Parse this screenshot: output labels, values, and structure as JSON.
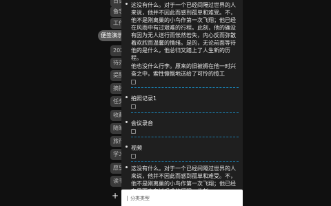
{
  "sidebar": {
    "tabs": [
      {
        "label": "日记"
      },
      {
        "label": "备忘"
      },
      {
        "label": "工作"
      },
      {
        "label": "便签演示"
      },
      {
        "label": "2023"
      },
      {
        "label": "待办"
      },
      {
        "label": "提醒"
      },
      {
        "label": "摘抄"
      },
      {
        "label": "任务"
      },
      {
        "label": "收藏"
      },
      {
        "label": "随笔"
      },
      {
        "label": "旅行"
      },
      {
        "label": "学习"
      },
      {
        "label": "愿望"
      },
      {
        "label": "读书"
      },
      {
        "label": "健身"
      }
    ],
    "add_label": "+"
  },
  "notes": {
    "entry1_text": "这没有什么。对于一个已经间隔过世界的人来说，他并不因此而感到孤单和难受。不，他不是刚离巢的小鸟作第一次飞翔；他已经在风雨中有过艰难的行程。此刻，他的确没有因为无人送行而怅然若失，内心反而弥散着欢欣而温馨的情绪。是的，无论前面等待他的是什么，他总归又踏上了人生新的历程。",
    "entry1_text2": "他也没什么行李。原来的旧被褥在他一时兴奋之中，索性慷慨地送给了可怜的揽工",
    "entry2_title": "拍照记录1",
    "entry3_title": "会议录音",
    "entry4_title": "视频",
    "entry5_text": "这没有什么。对于一个已经间隔过世界的人来说，他并不因此而感到孤单和难受。不，他不是刚离巢的小鸟作第一次飞翔；他已经在风雨中有过艰难的行程。此刻，"
  },
  "sheet": {
    "label": "分类类型"
  },
  "colors": {
    "panel_bg": "#1f1f1f",
    "divider": "#1a7fb0",
    "active_tab": "#5a5a5a"
  }
}
